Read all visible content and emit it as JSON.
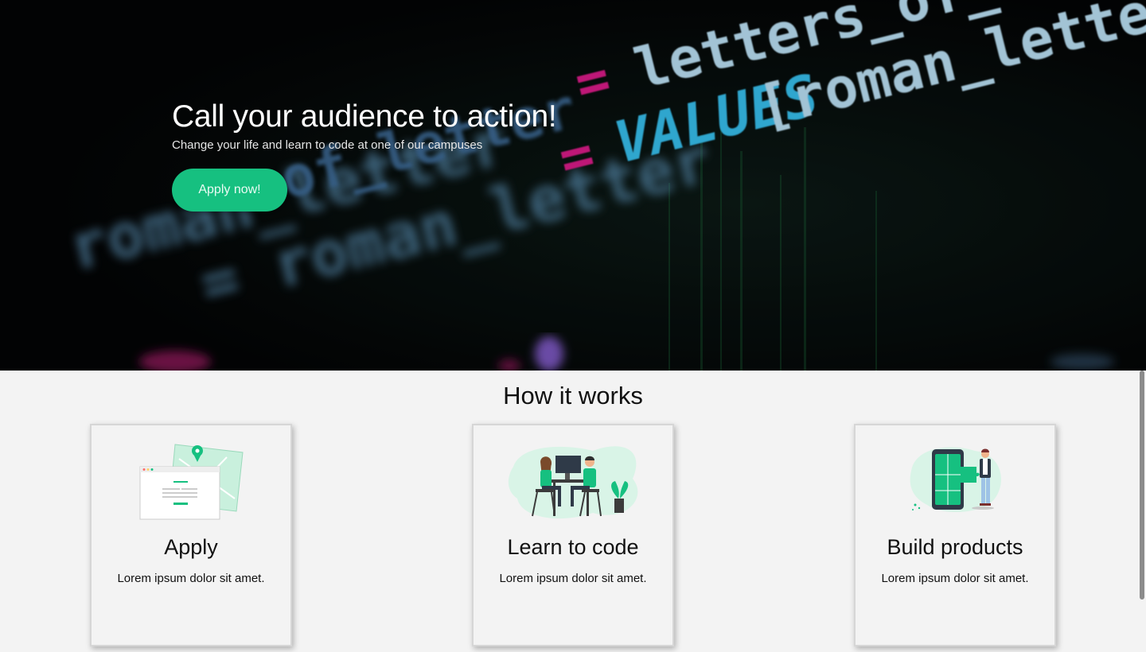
{
  "hero": {
    "title": "Call your audience to action!",
    "subtitle": "Change your life and learn to code at one of our campuses",
    "cta_label": "Apply now!",
    "background_code": {
      "line1": "letters_of_",
      "line2": "= letters_o",
      "line3": "VALUES[roman_lette",
      "line4": "roman_letter",
      "line5": "= roman_letter"
    }
  },
  "how_it_works": {
    "title": "How it works",
    "cards": [
      {
        "title": "Apply",
        "text": "Lorem ipsum dolor sit amet.",
        "illustration": "application-map-icon"
      },
      {
        "title": "Learn to code",
        "text": "Lorem ipsum dolor sit amet.",
        "illustration": "people-at-computer-icon"
      },
      {
        "title": "Build products",
        "text": "Lorem ipsum dolor sit amet.",
        "illustration": "phone-puzzle-icon"
      }
    ]
  },
  "colors": {
    "accent": "#16c080",
    "hero_background": "#05070a",
    "section_background": "#f3f3f3",
    "code_blue": "#9fd6f2",
    "code_pink": "#e01e8c"
  }
}
